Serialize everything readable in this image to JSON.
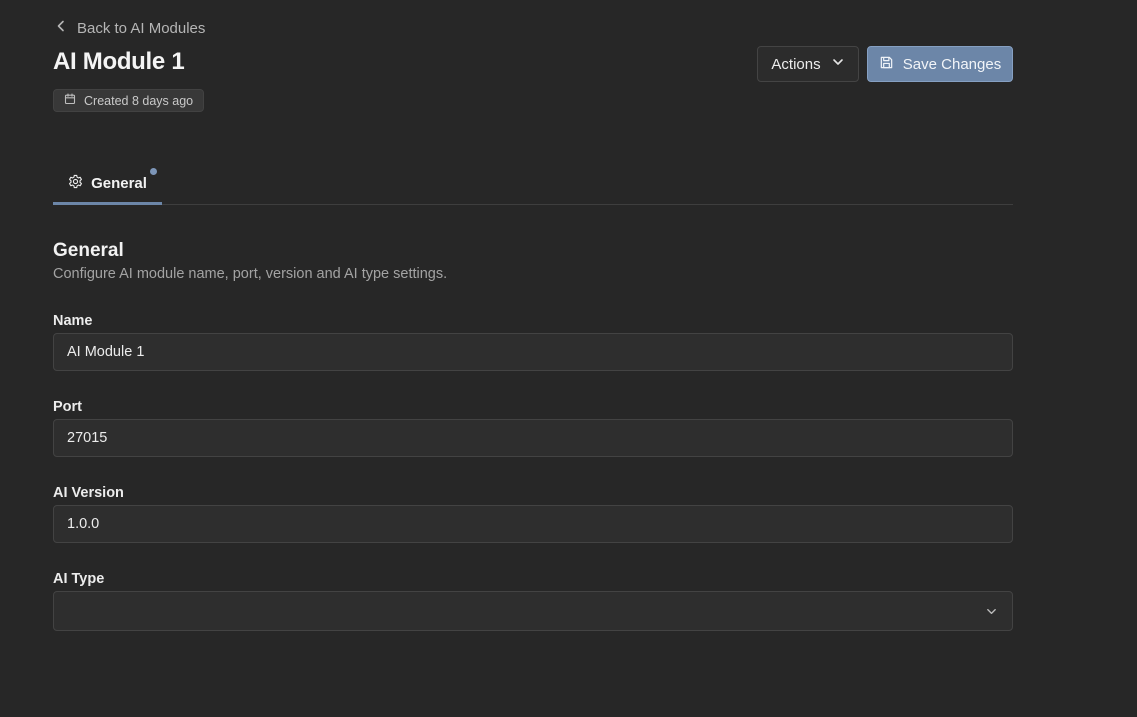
{
  "header": {
    "back_label": "Back to AI Modules",
    "title": "AI Module 1",
    "created_label": "Created 8 days ago",
    "actions_label": "Actions",
    "save_label": "Save Changes"
  },
  "tabs": [
    {
      "label": "General",
      "icon": "gear-icon",
      "active": true,
      "has_changes_indicator": true
    }
  ],
  "section": {
    "title": "General",
    "description": "Configure AI module name, port, version and AI type settings."
  },
  "form": {
    "name": {
      "label": "Name",
      "value": "AI Module 1"
    },
    "port": {
      "label": "Port",
      "value": "27015"
    },
    "ai_version": {
      "label": "AI Version",
      "value": "1.0.0"
    },
    "ai_type": {
      "label": "AI Type",
      "value": ""
    }
  },
  "colors": {
    "background": "#272727",
    "accent": "#6c86a8",
    "indicator_dot": "#7d96b8"
  }
}
